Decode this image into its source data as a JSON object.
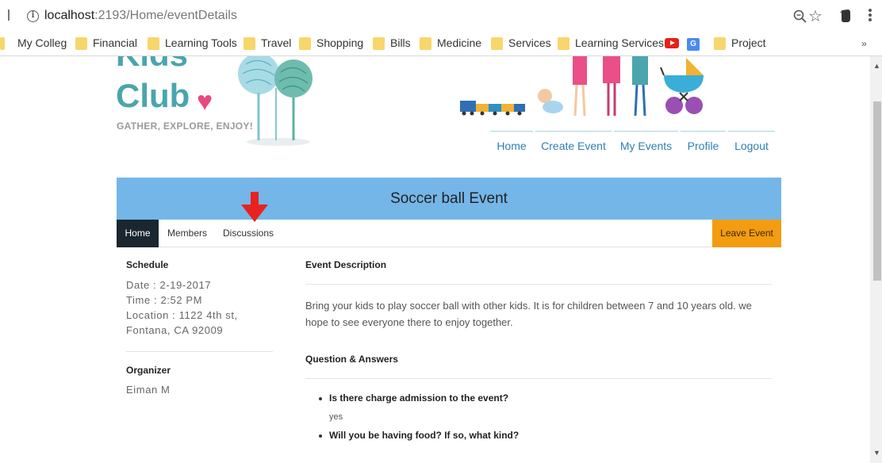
{
  "browser": {
    "url_host": "localhost",
    "url_path": ":2193/Home/eventDetails",
    "bookmarks": [
      {
        "label": "My Colleg",
        "icon": "none"
      },
      {
        "label": "Financial",
        "icon": "folder-icon"
      },
      {
        "label": "Learning Tools",
        "icon": "folder-icon"
      },
      {
        "label": "Travel",
        "icon": "folder-icon"
      },
      {
        "label": "Shopping",
        "icon": "folder-icon"
      },
      {
        "label": "Bills",
        "icon": "folder-icon"
      },
      {
        "label": "Medicine",
        "icon": "folder-icon"
      },
      {
        "label": "Services",
        "icon": "folder-icon"
      },
      {
        "label": "Learning Services",
        "icon": "folder-icon"
      },
      {
        "label": "",
        "icon": "youtube-icon"
      },
      {
        "label": "",
        "icon": "google-translate-icon"
      },
      {
        "label": "Project",
        "icon": "folder-icon"
      }
    ],
    "more_bookmarks": "»"
  },
  "site": {
    "logo_line1": "Kids",
    "logo_line2": "Club",
    "tagline": "GATHER, EXPLORE, ENJOY!",
    "nav": [
      "Home",
      "Create Event",
      "My Events",
      "Profile",
      "Logout"
    ]
  },
  "event": {
    "title": "Soccer ball Event",
    "tabs": {
      "home": "Home",
      "members": "Members",
      "discussions": "Discussions",
      "leave": "Leave Event"
    },
    "schedule": {
      "heading": "Schedule",
      "date": "Date : 2-19-2017",
      "time": "Time : 2:52 PM",
      "location_line1": "Location : 1122 4th st,",
      "location_line2": "Fontana, CA 92009"
    },
    "organizer": {
      "heading": "Organizer",
      "name": "Eiman M"
    },
    "description": {
      "heading": "Event Description",
      "line1": "Bring your kids to play soccer ball with other kids. It is for children between 7 and 10 years old. we",
      "line2": "hope to see everyone there to enjoy together."
    },
    "qa": {
      "heading": "Question & Answers",
      "items": [
        {
          "q": "Is there charge admission to the event?",
          "a": "yes"
        },
        {
          "q": "Will you be having food? If so, what kind?",
          "a": ""
        }
      ]
    }
  },
  "colors": {
    "brand_teal": "#4aa5ad",
    "title_bar": "#74b6e8",
    "tab_active": "#1a2630",
    "leave_button": "#f39c12",
    "annotation_arrow": "#e8231f"
  }
}
